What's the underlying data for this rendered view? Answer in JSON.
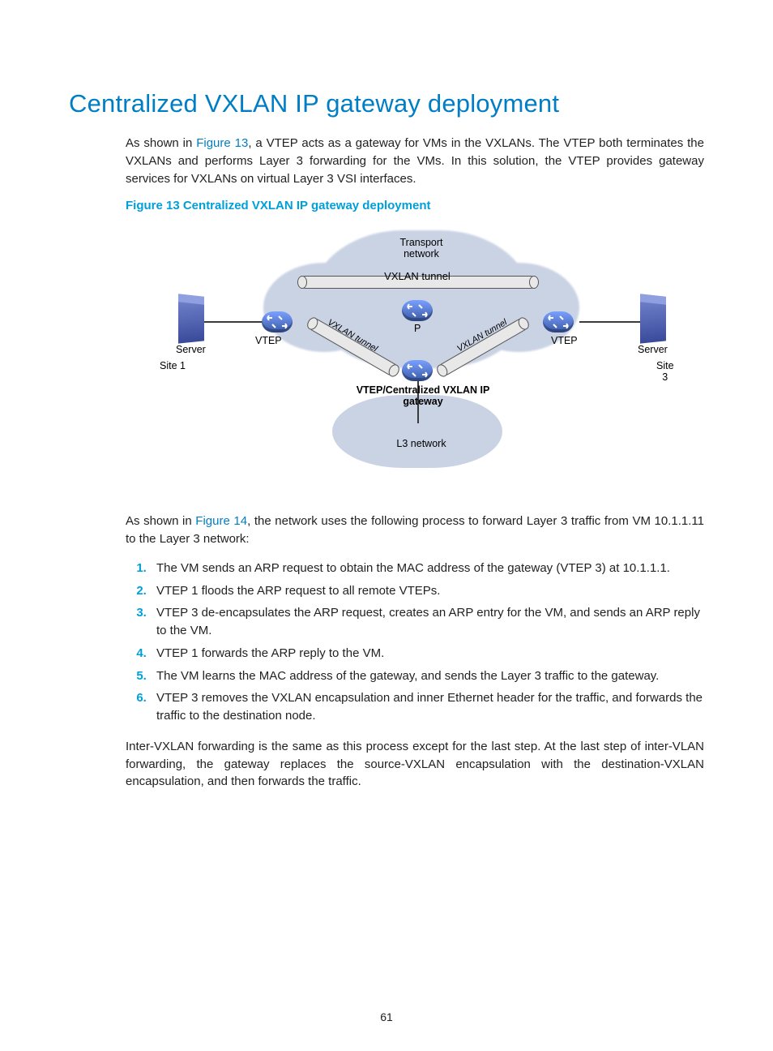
{
  "heading": "Centralized VXLAN IP gateway deployment",
  "intro_pre": "As shown in ",
  "intro_link": "Figure 13",
  "intro_post": ", a VTEP acts as a gateway for VMs in the VXLANs. The VTEP both terminates the VXLANs and performs Layer 3 forwarding for the VMs. In this solution, the VTEP provides gateway services for VXLANs on virtual Layer 3 VSI interfaces.",
  "fig_caption": "Figure 13 Centralized VXLAN IP gateway deployment",
  "fig": {
    "transport": "Transport network",
    "tunnel_top": "VXLAN tunnel",
    "tunnel_left": "VXLAN tunnel",
    "tunnel_right": "VXLAN tunnel",
    "vtep_left": "VTEP",
    "vtep_right": "VTEP",
    "p": "P",
    "server_left": "Server",
    "server_right": "Server",
    "site1": "Site 1",
    "site3": "Site 3",
    "gateway": "VTEP/Centralized VXLAN IP gateway",
    "l3": "L3 network"
  },
  "para2_pre": "As shown in ",
  "para2_link": "Figure 14",
  "para2_post": ", the network uses the following process to forward Layer 3 traffic from VM 10.1.1.11 to the Layer 3 network:",
  "steps": [
    "The VM sends an ARP request to obtain the MAC address of the gateway (VTEP 3) at 10.1.1.1.",
    "VTEP 1 floods the ARP request to all remote VTEPs.",
    "VTEP 3 de-encapsulates the ARP request, creates an ARP entry for the VM, and sends an ARP reply to the VM.",
    "VTEP 1 forwards the ARP reply to the VM.",
    "The VM learns the MAC address of the gateway, and sends the Layer 3 traffic to the gateway.",
    "VTEP 3 removes the VXLAN encapsulation and inner Ethernet header for the traffic, and forwards the traffic to the destination node."
  ],
  "para3": "Inter-VXLAN forwarding is the same as this process except for the last step. At the last step of inter-VLAN forwarding, the gateway replaces the source-VXLAN encapsulation with the destination-VXLAN encapsulation, and then forwards the traffic.",
  "page_number": "61"
}
